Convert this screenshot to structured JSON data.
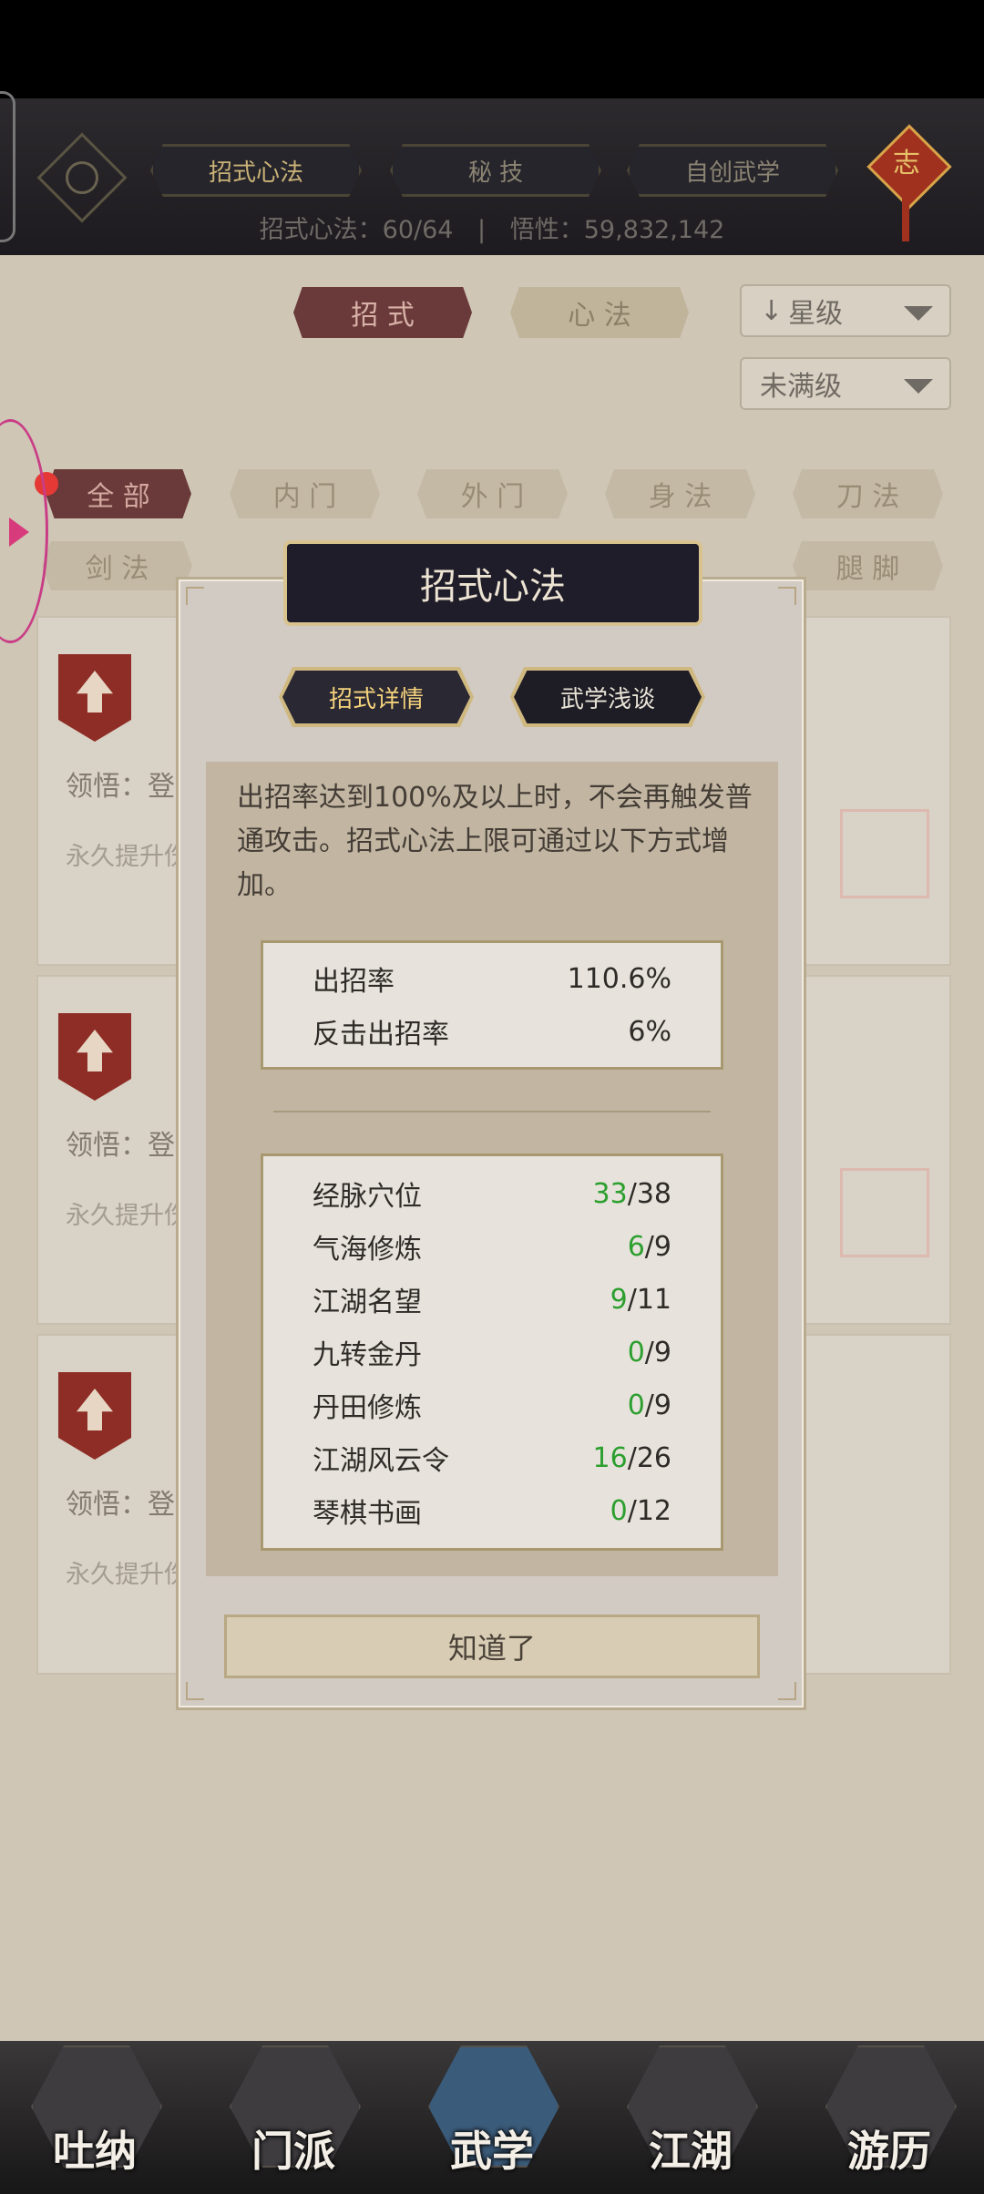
{
  "top_tabs": [
    "招式心法",
    "秘 技",
    "自创武学"
  ],
  "top_stats": {
    "label1": "招式心法：60/64",
    "sep": "|",
    "label2": "悟性：59,832,142"
  },
  "knot_char": "志",
  "segment": {
    "left": "招 式",
    "right": "心 法"
  },
  "sort_dropdown": "星级",
  "sort_arrow": "↓",
  "filter_dropdown": "未满级",
  "categories": [
    "全 部",
    "内 门",
    "外 门",
    "身 法",
    "刀 法",
    "剑 法",
    "腿 脚"
  ],
  "cards": [
    {
      "label": "领悟：登",
      "sub": "永久提升伤"
    },
    {
      "label": "领悟：登",
      "sub": "永久提升伤"
    },
    {
      "label": "领悟：登",
      "sub": "永久提升伤"
    }
  ],
  "nav": [
    "吐纳",
    "门派",
    "武学",
    "江湖",
    "游历"
  ],
  "dialog": {
    "title": "招式心法",
    "tabs": [
      "招式详情",
      "武学浅谈"
    ],
    "description": "出招率达到100%及以上时，不会再触发普通攻击。招式心法上限可通过以下方式增加。",
    "rates": [
      {
        "label": "出招率",
        "value": "110.6%"
      },
      {
        "label": "反击出招率",
        "value": "6%"
      }
    ],
    "sources": [
      {
        "label": "经脉穴位",
        "current": "33",
        "max": "/38"
      },
      {
        "label": "气海修炼",
        "current": "6",
        "max": "/9"
      },
      {
        "label": "江湖名望",
        "current": "9",
        "max": "/11"
      },
      {
        "label": "九转金丹",
        "current": "0",
        "max": "/9"
      },
      {
        "label": "丹田修炼",
        "current": "0",
        "max": "/9"
      },
      {
        "label": "江湖风云令",
        "current": "16",
        "max": "/26"
      },
      {
        "label": "琴棋书画",
        "current": "0",
        "max": "/12"
      }
    ],
    "ok_label": "知道了"
  },
  "colors": {
    "accent_green": "#2d9f2f",
    "title_plate": "#1f1d29",
    "gold_border": "#d8c38f"
  }
}
